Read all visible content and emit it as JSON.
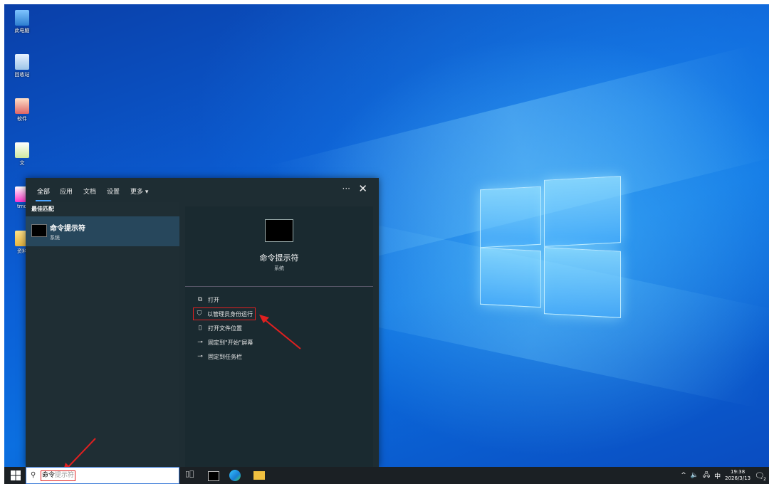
{
  "desktop": {
    "icons": [
      {
        "label": "此电脑",
        "icon": "computer-icon"
      },
      {
        "label": "回收站",
        "icon": "recycle-bin-icon"
      },
      {
        "label": "软件",
        "icon": "app-icon"
      },
      {
        "label": "文",
        "icon": "document-icon"
      },
      {
        "label": "tmd",
        "icon": "file-icon"
      },
      {
        "label": "资料",
        "icon": "folder-icon"
      }
    ]
  },
  "start_menu": {
    "tabs": [
      "全部",
      "应用",
      "文档",
      "设置",
      "更多 ▾"
    ],
    "active_tab": "全部",
    "more_label": "···",
    "close_label": "✕",
    "best_match_label": "最佳匹配",
    "best_match": {
      "name": "命令提示符",
      "subtitle": "系统"
    },
    "detail": {
      "title": "命令提示符",
      "subtitle": "系统",
      "actions": [
        {
          "label": "打开",
          "icon": "open-icon"
        },
        {
          "label": "以管理员身份运行",
          "icon": "admin-shield-icon",
          "highlighted": true
        },
        {
          "label": "打开文件位置",
          "icon": "file-location-icon"
        },
        {
          "label": "固定到\"开始\"屏幕",
          "icon": "pin-icon"
        },
        {
          "label": "固定到任务栏",
          "icon": "pin-icon"
        }
      ]
    }
  },
  "taskbar": {
    "search_typed": "命令",
    "search_suggest": "提示符",
    "tray": {
      "chevron": "^",
      "volume": "🔈",
      "network": "🖧",
      "ime": "中",
      "time": "19:38",
      "date": "2026/3/13",
      "notification_count": "2"
    }
  },
  "colors": {
    "highlight_border": "#e02020",
    "menu_bg": "#1e2d33",
    "selected_item": "#27475c"
  }
}
